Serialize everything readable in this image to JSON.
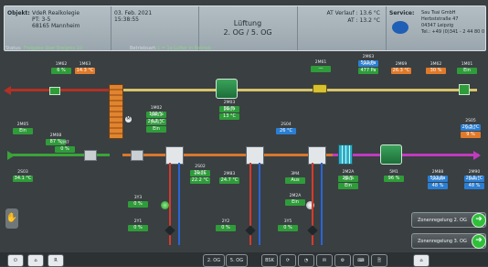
{
  "header": {
    "objekt_label": "Objekt:",
    "objekt_lines": [
      "VdeR Realkolegie",
      "PT: 3-5",
      "68165 Mannheim"
    ],
    "date": "03. Feb. 2021",
    "time": "15:38:55",
    "title": "Lüftung",
    "subtitle": "2. OG / 5. OG",
    "at_verlauf": "AT Verlauf : 13.6 °C",
    "at": "AT : 13.2 °C",
    "service_label": "Service:",
    "service_lines": [
      "Sau Tsai GmbH",
      "Herbststraße 47",
      "04347 Leipzig",
      "Tel.: +49 (0)341 - 2 44 80 0"
    ]
  },
  "infobar": {
    "status_label": "Status:",
    "status_value": "Freigabe über Ereignis 10",
    "betriebsart_label": "Betriebsart:",
    "betriebsart_value": "1 = 1e Lüfter in Betrieb"
  },
  "sensors": [
    {
      "tag": "1M62",
      "value": "6 %",
      "color": "vg"
    },
    {
      "tag": "1M63",
      "value": "14.3 °C",
      "color": "vo"
    },
    {
      "tag": "2M61",
      "value": "—",
      "color": "vg"
    },
    {
      "tag": "2M63",
      "value": "513 Pa",
      "color": "vb"
    },
    {
      "tag": "2M62",
      "value": "477 Pa",
      "color": "vg"
    },
    {
      "tag": "2M69",
      "value": "26.3 °C",
      "color": "vo"
    },
    {
      "tag": "3M62",
      "value": "30 %",
      "color": "vo"
    },
    {
      "tag": "1M01",
      "value": "Ein",
      "color": "vg"
    },
    {
      "tag": "1M02",
      "value": "100 %",
      "color": "vg"
    },
    {
      "tag": "1M03",
      "value": "24.7 °C",
      "color": "vg"
    },
    {
      "tag": "2M02",
      "value": "Ein",
      "color": "vg"
    },
    {
      "tag": "2M03",
      "value": "86 %",
      "color": "vg"
    },
    {
      "tag": "2M07",
      "value": "13 °C",
      "color": "vg"
    },
    {
      "tag": "2M05",
      "value": "Ein",
      "color": "vg"
    },
    {
      "tag": "2M08",
      "value": "87 %",
      "color": "vg"
    },
    {
      "tag": "2S03",
      "value": "34.1 °C",
      "color": "vg"
    },
    {
      "tag": "2S04",
      "value": "26 °C",
      "color": "vb"
    },
    {
      "tag": "2S05",
      "value": "26.3 °C",
      "color": "vb"
    },
    {
      "tag": "2S02",
      "value": "9 %",
      "color": "vo"
    },
    {
      "tag": "2S02b",
      "value": "31 °C",
      "color": "vg"
    },
    {
      "tag": "2M84",
      "value": "22.2 °C",
      "color": "vg"
    },
    {
      "tag": "2M83",
      "value": "24.7 °C",
      "color": "vg"
    },
    {
      "tag": "3M4",
      "value": "Aus",
      "color": "vg"
    },
    {
      "tag": "2M2A",
      "value": "Ein",
      "color": "vg"
    },
    {
      "tag": "2M2Ab",
      "value": "28 %",
      "color": "vg"
    },
    {
      "tag": "5M1",
      "value": "Ein",
      "color": "vg"
    },
    {
      "tag": "5M1b",
      "value": "96 %",
      "color": "vg"
    },
    {
      "tag": "2M88",
      "value": "513 Pa",
      "color": "vb"
    },
    {
      "tag": "2M89",
      "value": "48 %",
      "color": "vb"
    },
    {
      "tag": "2M90",
      "value": "26.5 °C",
      "color": "vb"
    },
    {
      "tag": "2M91",
      "value": "48 %",
      "color": "vb"
    },
    {
      "tag": "3Y3",
      "value": "0 %",
      "color": "vg"
    },
    {
      "tag": "2Y1",
      "value": "0 %",
      "color": "vg"
    },
    {
      "tag": "2Y2",
      "value": "0 %",
      "color": "vg"
    },
    {
      "tag": "3Y5",
      "value": "0 %",
      "color": "vg"
    },
    {
      "tag": "2M7",
      "value": "0 %",
      "color": "vg"
    }
  ],
  "zones": [
    {
      "label": "Zonenregelung 2. OG",
      "go": "➜"
    },
    {
      "label": "Zonenregelung 3. OG",
      "go": "➜"
    }
  ],
  "bottom": {
    "buttons_left": [
      "⏻",
      "⌂",
      "R"
    ],
    "floor1": "2. OG",
    "floor2": "5. OG",
    "buttons_mid": [
      "BSK",
      "⟳",
      "◔",
      "✉",
      "⚙",
      "⌨",
      "🗎"
    ],
    "home": "⌂"
  }
}
